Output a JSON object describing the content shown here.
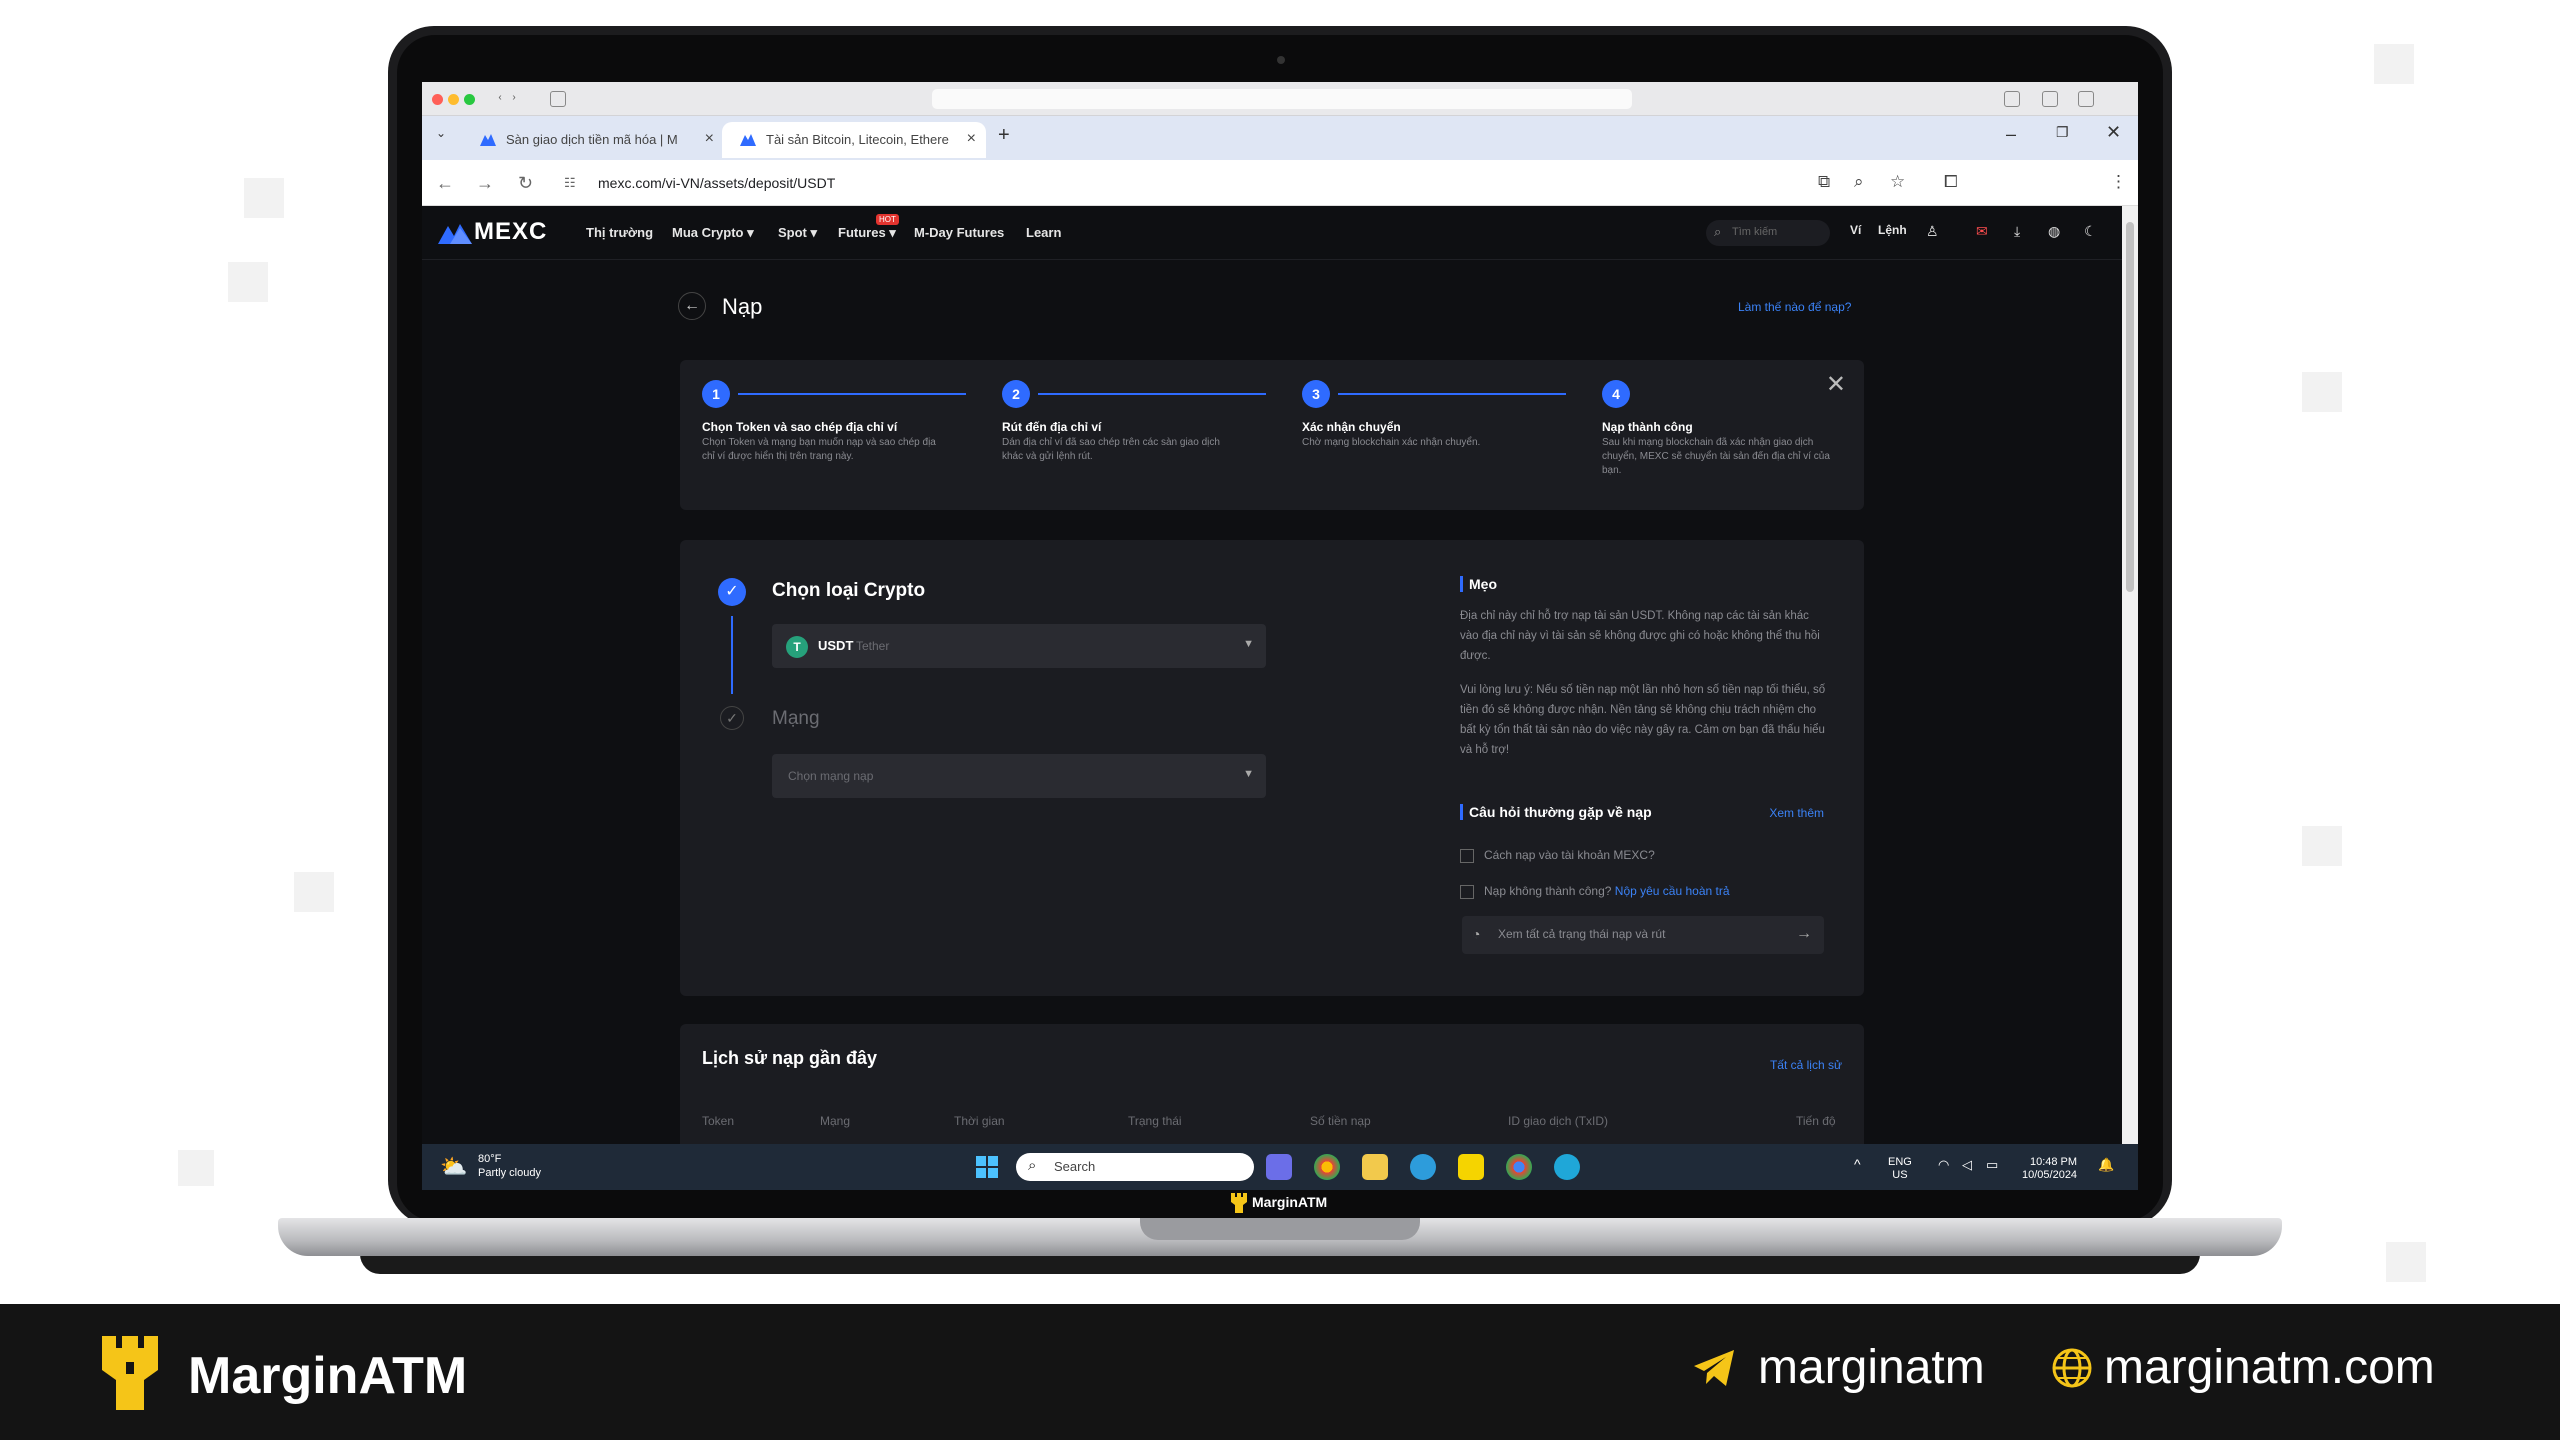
{
  "browser": {
    "tabs": [
      {
        "label": "Sàn giao dịch tiền mã hóa | M"
      },
      {
        "label": "Tài sản Bitcoin, Litecoin, Ethere"
      }
    ],
    "url": "mexc.com/vi-VN/assets/deposit/USDT"
  },
  "nav": {
    "logo": "MEXC",
    "items": [
      "Thị trường",
      "Mua Crypto ▾",
      "Spot ▾",
      "Futures ▾",
      "M-Day Futures",
      "Learn"
    ],
    "hot_badge": "HOT",
    "search_placeholder": "Tìm kiếm",
    "wallet": "Ví",
    "orders": "Lệnh"
  },
  "page": {
    "title": "Nạp",
    "help_link": "Làm thế nào để nạp?"
  },
  "steps": [
    {
      "num": "1",
      "title": "Chọn Token và sao chép địa chỉ ví",
      "desc": "Chọn Token và mạng bạn muốn nạp và sao chép địa chỉ ví được hiển thị trên trang này."
    },
    {
      "num": "2",
      "title": "Rút đến địa chỉ ví",
      "desc": "Dán địa chỉ ví đã sao chép trên các sàn giao dịch khác và gửi lệnh rút."
    },
    {
      "num": "3",
      "title": "Xác nhận chuyển",
      "desc": "Chờ mạng blockchain xác nhận chuyển."
    },
    {
      "num": "4",
      "title": "Nạp thành công",
      "desc": "Sau khi mạng blockchain đã xác nhận giao dịch chuyển, MEXC sẽ chuyển tài sản đến địa chỉ ví của bạn."
    }
  ],
  "form": {
    "crypto_label": "Chọn loại Crypto",
    "coin_symbol": "USDT",
    "coin_name": "Tether",
    "network_label": "Mạng",
    "network_placeholder": "Chọn mạng nạp"
  },
  "tips": {
    "title": "Mẹo",
    "p1": "Địa chỉ này chỉ hỗ trợ nạp tài sản USDT. Không nạp các tài sản khác vào địa chỉ này vì tài sản sẽ không được ghi có hoặc không thể thu hồi được.",
    "p2": "Vui lòng lưu ý: Nếu số tiền nạp một lần nhỏ hơn số tiền nạp tối thiểu, số tiền đó sẽ không được nhận. Nền tảng sẽ không chịu trách nhiệm cho bất kỳ tổn thất tài sản nào do việc này gây ra. Cảm ơn bạn đã thấu hiểu và hỗ trợ!"
  },
  "faq": {
    "title": "Câu hỏi thường gặp về nạp",
    "more": "Xem thêm",
    "q1": "Cách nạp vào tài khoản MEXC?",
    "q2": "Nạp không thành công?",
    "q2_link": "Nộp yêu cầu hoàn trả",
    "status_btn": "Xem tất cả trạng thái nạp và rút"
  },
  "history": {
    "title": "Lịch sử nạp gần đây",
    "all": "Tất cả lịch sử",
    "columns": [
      "Token",
      "Mạng",
      "Thời gian",
      "Trạng thái",
      "Số tiền nạp",
      "ID giao dịch (TxID)",
      "Tiến độ"
    ]
  },
  "taskbar": {
    "temp": "80°F",
    "weather": "Partly cloudy",
    "search": "Search",
    "lang1": "ENG",
    "lang2": "US",
    "time": "10:48 PM",
    "date": "10/05/2024"
  },
  "laptop_label": "MarginATM",
  "footer": {
    "brand": "MarginATM",
    "telegram": "marginatm",
    "website": "marginatm.com"
  },
  "colors": {
    "accent": "#2f6bff",
    "link": "#3b82f6",
    "bg": "#0e0f12",
    "card": "#1b1c21",
    "brand_gold": "#f5c518"
  }
}
